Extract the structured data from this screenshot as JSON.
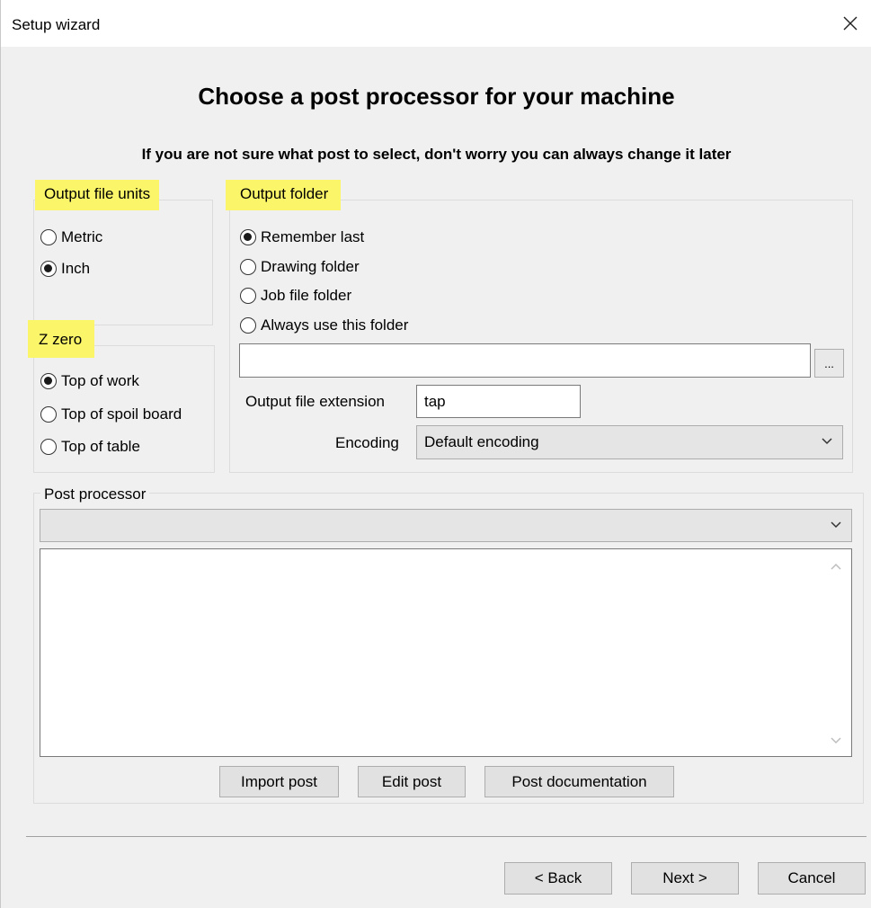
{
  "window": {
    "title": "Setup wizard"
  },
  "header": {
    "heading": "Choose a post processor for your machine",
    "subheading": "If you are not sure what post to select, don't worry you can always change it later"
  },
  "output_units": {
    "label": "Output file units",
    "options": [
      "Metric",
      "Inch"
    ],
    "selected": "Inch"
  },
  "z_zero": {
    "label": "Z zero",
    "options": [
      "Top of work",
      "Top of spoil board",
      "Top of table"
    ],
    "selected": "Top of work"
  },
  "output_folder": {
    "label": "Output folder",
    "options": [
      "Remember last",
      "Drawing folder",
      "Job file folder",
      "Always use this folder"
    ],
    "selected": "Remember last",
    "folder_path": "",
    "browse_label": "...",
    "extension_label": "Output file extension",
    "extension_value": "tap",
    "encoding_label": "Encoding",
    "encoding_value": "Default encoding"
  },
  "post_processor": {
    "label": "Post processor",
    "selected": "",
    "description": "",
    "buttons": {
      "import": "Import post",
      "edit": "Edit post",
      "documentation": "Post documentation"
    }
  },
  "footer": {
    "back": "< Back",
    "next": "Next >",
    "cancel": "Cancel"
  },
  "colors": {
    "highlight": "#fbf56a",
    "dialog_bg": "#f0f0f0"
  },
  "icons": {
    "close": "close-icon",
    "chevron": "chevron-down-icon"
  }
}
